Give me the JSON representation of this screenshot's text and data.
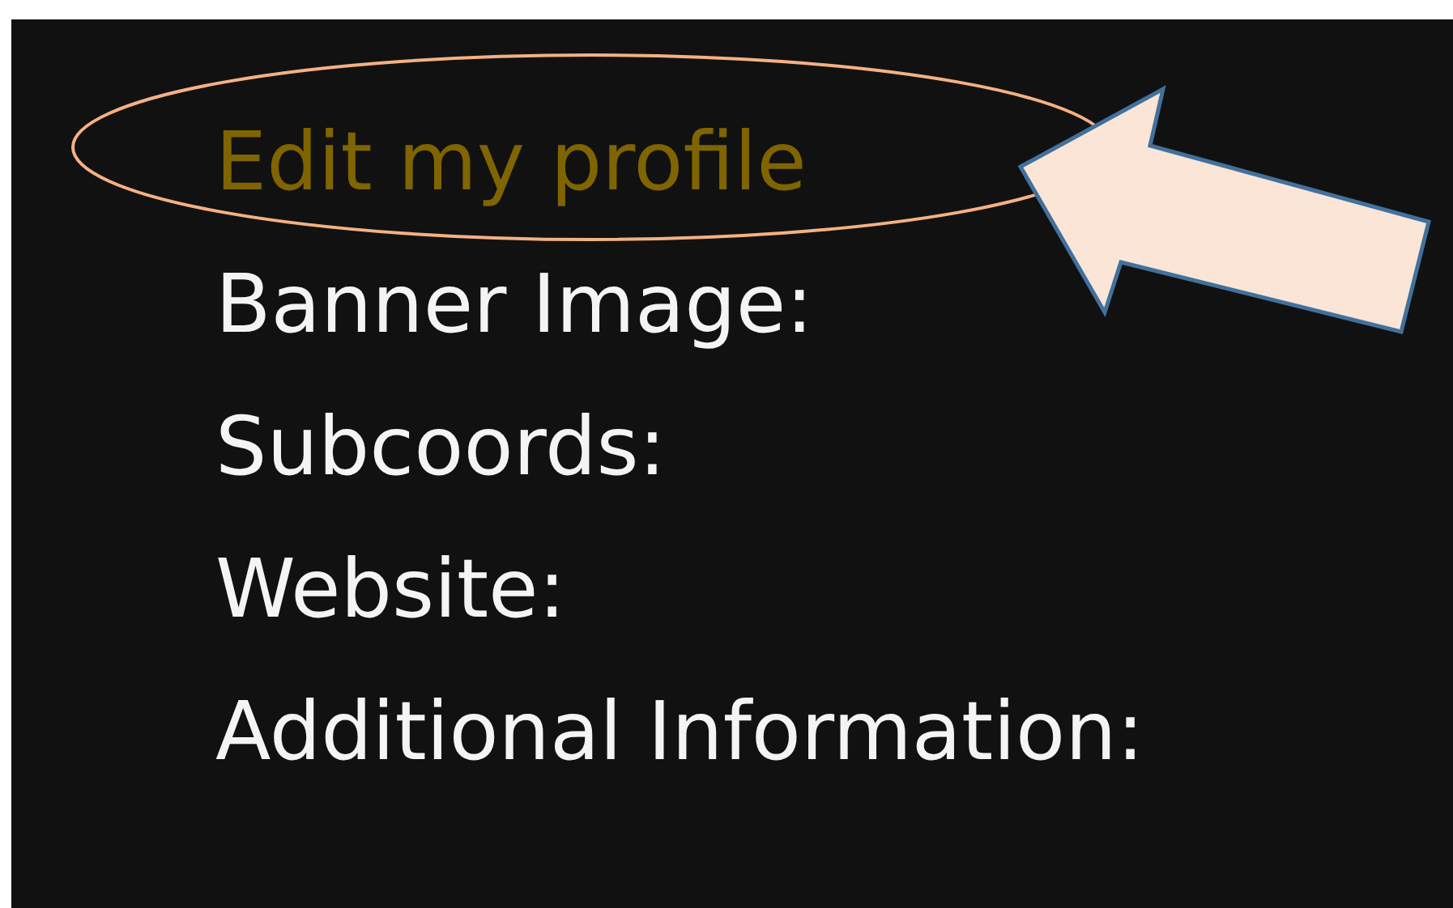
{
  "profile_lines": [
    {
      "kind": "link",
      "text": "Edit my profile"
    },
    {
      "kind": "label",
      "text": "Banner Image:"
    },
    {
      "kind": "label",
      "text": "Subcoords:"
    },
    {
      "kind": "label",
      "text": "Website:"
    },
    {
      "kind": "label",
      "text": "Additional Information:"
    }
  ]
}
